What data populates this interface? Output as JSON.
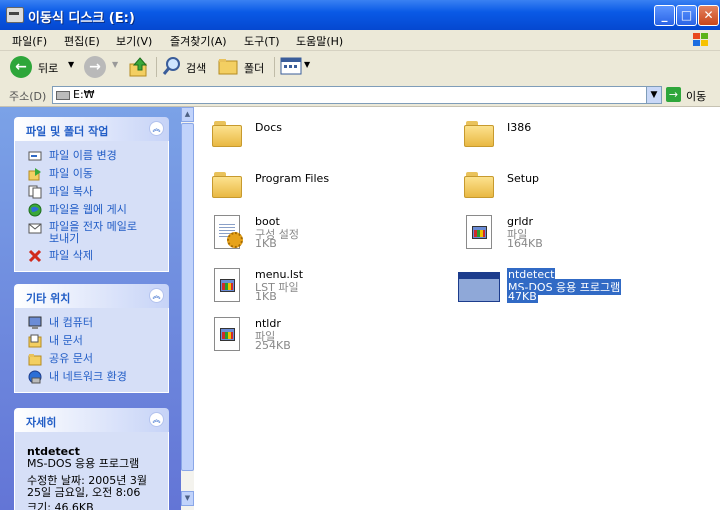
{
  "window": {
    "title": "이동식 디스크 (E:)",
    "min": "_",
    "max": "□",
    "close": "✕"
  },
  "menu": [
    "파일(F)",
    "편집(E)",
    "보기(V)",
    "즐겨찾기(A)",
    "도구(T)",
    "도움말(H)"
  ],
  "toolbar": {
    "back": "뒤로",
    "search": "검색",
    "folders": "폴더"
  },
  "address": {
    "label": "주소(D)",
    "value": "E:₩",
    "go": "이동"
  },
  "panels": {
    "tasks": {
      "title": "파일 및 폴더 작업",
      "items": [
        "파일 이름 변경",
        "파일 이동",
        "파일 복사",
        "파일을 웹에 게시",
        "파일을 전자 메일로",
        "보내기",
        "파일 삭제"
      ]
    },
    "places": {
      "title": "기타 위치",
      "items": [
        "내 컴퓨터",
        "내 문서",
        "공유 문서",
        "내 네트워크 환경"
      ]
    },
    "details": {
      "title": "자세히",
      "name": "ntdetect",
      "type": "MS-DOS 응용 프로그램",
      "modified_label": "수정한 날짜: 2005년 3월",
      "modified_value": "25일 금요일, 오전 8:06",
      "size": "크기: 46.6KB"
    }
  },
  "files": [
    {
      "name": "Docs",
      "kind": "folder"
    },
    {
      "name": "I386",
      "kind": "folder"
    },
    {
      "name": "Program Files",
      "kind": "folder"
    },
    {
      "name": "Setup",
      "kind": "folder"
    },
    {
      "name": "boot",
      "type": "구성 설정",
      "size": "1KB",
      "kind": "config"
    },
    {
      "name": "grldr",
      "type": "파일",
      "size": "164KB",
      "kind": "file"
    },
    {
      "name": "menu.lst",
      "type": "LST 파일",
      "size": "1KB",
      "kind": "file"
    },
    {
      "name": "ntdetect",
      "type": "MS-DOS 응용 프로그램",
      "size": "47KB",
      "kind": "app",
      "selected": true
    },
    {
      "name": "ntldr",
      "type": "파일",
      "size": "254KB",
      "kind": "file"
    }
  ]
}
